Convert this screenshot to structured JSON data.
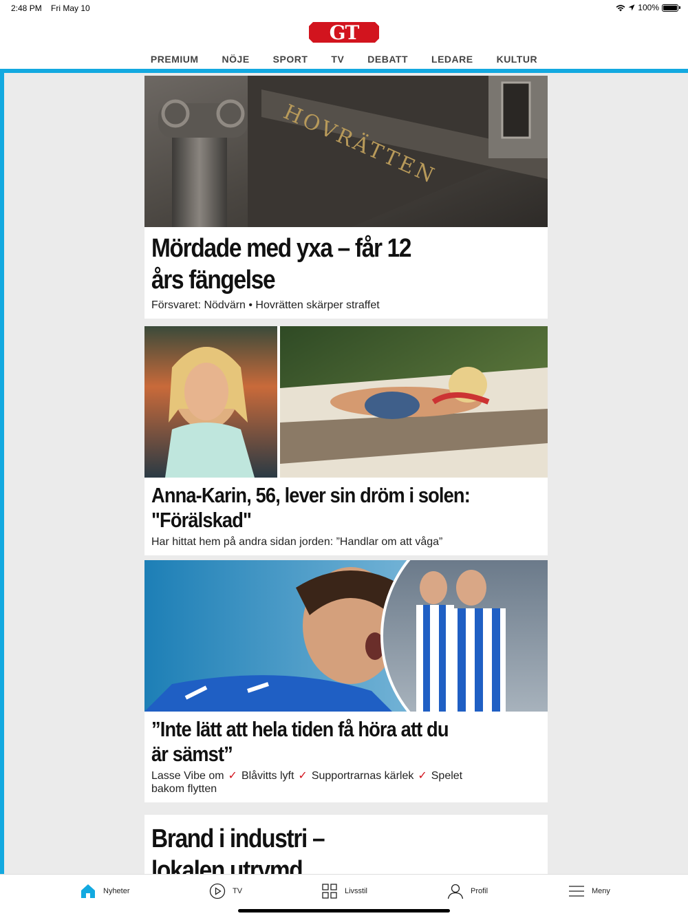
{
  "status_bar": {
    "time": "2:48 PM",
    "date": "Fri May 10",
    "battery": "100%"
  },
  "header": {
    "logo_text": "GT",
    "brand_color": "#d2141e",
    "accent_color": "#13a9e0",
    "nav": [
      "PREMIUM",
      "NÖJE",
      "SPORT",
      "TV",
      "DEBATT",
      "LEDARE",
      "KULTUR"
    ]
  },
  "articles": [
    {
      "image": "court-building-hovratten-photo",
      "image_text": "HOVRÄTTEN",
      "headline_line1": "Mördade med yxa – får 12",
      "headline_line2": "års fängelse",
      "subtitle": "Försvaret: Nödvärn • Hovrätten skärper straffet"
    },
    {
      "image": "woman-on-beach-palm-tree-photos",
      "headline_line1": "Anna-Karin, 56, lever sin dröm i solen:",
      "headline_line2": "\"Förälskad\"",
      "subtitle": "Har hittat hem på andra sidan jorden: ”Handlar om att våga”"
    },
    {
      "image": "football-player-blue-white-jersey-photos",
      "headline_line1": "”Inte lätt att hela tiden få höra att du",
      "headline_line2": "är sämst”",
      "sub_parts": [
        "Lasse Vibe om",
        "Blåvitts lyft",
        "Supportrarnas kärlek",
        "Spelet"
      ],
      "sub_tail": "bakom flytten",
      "check_mark": "✓"
    },
    {
      "headline_line1": "Brand i industri –",
      "headline_line2": "lokalen utrymd"
    }
  ],
  "tabbar": [
    {
      "label": "Nyheter",
      "icon": "home-icon",
      "active": true
    },
    {
      "label": "TV",
      "icon": "play-icon"
    },
    {
      "label": "Livsstil",
      "icon": "grid-icon"
    },
    {
      "label": "Profil",
      "icon": "user-icon"
    },
    {
      "label": "Meny",
      "icon": "menu-icon"
    }
  ]
}
